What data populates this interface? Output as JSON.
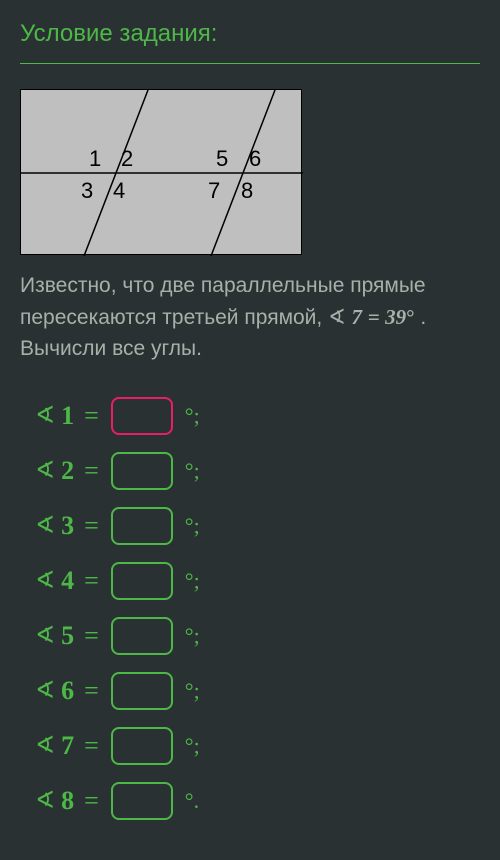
{
  "title": "Условие задания:",
  "figure": {
    "labels": {
      "l1": "1",
      "l2": "2",
      "l3": "3",
      "l4": "4",
      "l5": "5",
      "l6": "6",
      "l7": "7",
      "l8": "8"
    }
  },
  "description": {
    "line1": "Известно, что две параллельные прямые",
    "line2a": "пересекаются третьей прямой, ",
    "angle_sym": "∢",
    "given_angle": "7",
    "eq": "=",
    "given_value": "39",
    "deg": "°",
    "line3": "Вычисли все углы."
  },
  "angles": [
    {
      "num": "1",
      "active": true,
      "suffix": "°;"
    },
    {
      "num": "2",
      "active": false,
      "suffix": "°;"
    },
    {
      "num": "3",
      "active": false,
      "suffix": "°;"
    },
    {
      "num": "4",
      "active": false,
      "suffix": "°;"
    },
    {
      "num": "5",
      "active": false,
      "suffix": "°;"
    },
    {
      "num": "6",
      "active": false,
      "suffix": "°;"
    },
    {
      "num": "7",
      "active": false,
      "suffix": "°;"
    },
    {
      "num": "8",
      "active": false,
      "suffix": "°."
    }
  ],
  "angle_label_sym": "∢",
  "eq_sym": "="
}
